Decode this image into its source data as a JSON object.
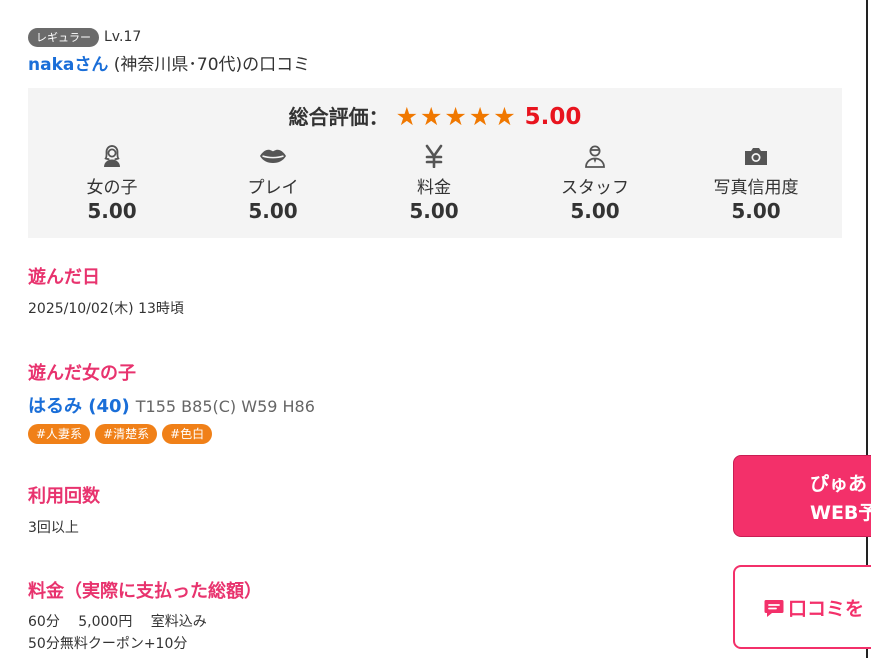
{
  "reviewer": {
    "badge": "レギュラー",
    "level": "Lv.17",
    "name": "nakaさん",
    "info": " (神奈川県･70代)の口コミ"
  },
  "summary": {
    "overall_label": "総合評価：",
    "stars": "★★★★★",
    "overall_score": "5.00",
    "categories": [
      {
        "icon": "woman-icon",
        "label": "女の子",
        "value": "5.00"
      },
      {
        "icon": "lips-icon",
        "label": "プレイ",
        "value": "5.00"
      },
      {
        "icon": "yen-icon",
        "label": "料金",
        "value": "5.00"
      },
      {
        "icon": "staff-icon",
        "label": "スタッフ",
        "value": "5.00"
      },
      {
        "icon": "camera-icon",
        "label": "写真信用度",
        "value": "5.00"
      }
    ]
  },
  "visit_date": {
    "title": "遊んだ日",
    "value": "2025/10/02(木) 13時頃"
  },
  "girl": {
    "title": "遊んだ女の子",
    "name": "はるみ (40)",
    "stats": "T155 B85(C) W59 H86",
    "tags": [
      "#人妻系",
      "#清楚系",
      "#色白"
    ]
  },
  "usage": {
    "title": "利用回数",
    "value": "3回以上"
  },
  "price": {
    "title": "料金（実際に支払った総額）",
    "line1": "60分　 5,000円　 室料込み",
    "line2": "50分無料クーポン+10分"
  },
  "floating": {
    "reserve_line1": "ぴゅあ",
    "reserve_line2": "WEB予",
    "review_label": "口コミを"
  },
  "colors": {
    "accent_pink": "#e8336e",
    "link_blue": "#1a6ed8",
    "star_orange": "#f07800",
    "score_red": "#e8141e",
    "tag_orange": "#f08018"
  }
}
